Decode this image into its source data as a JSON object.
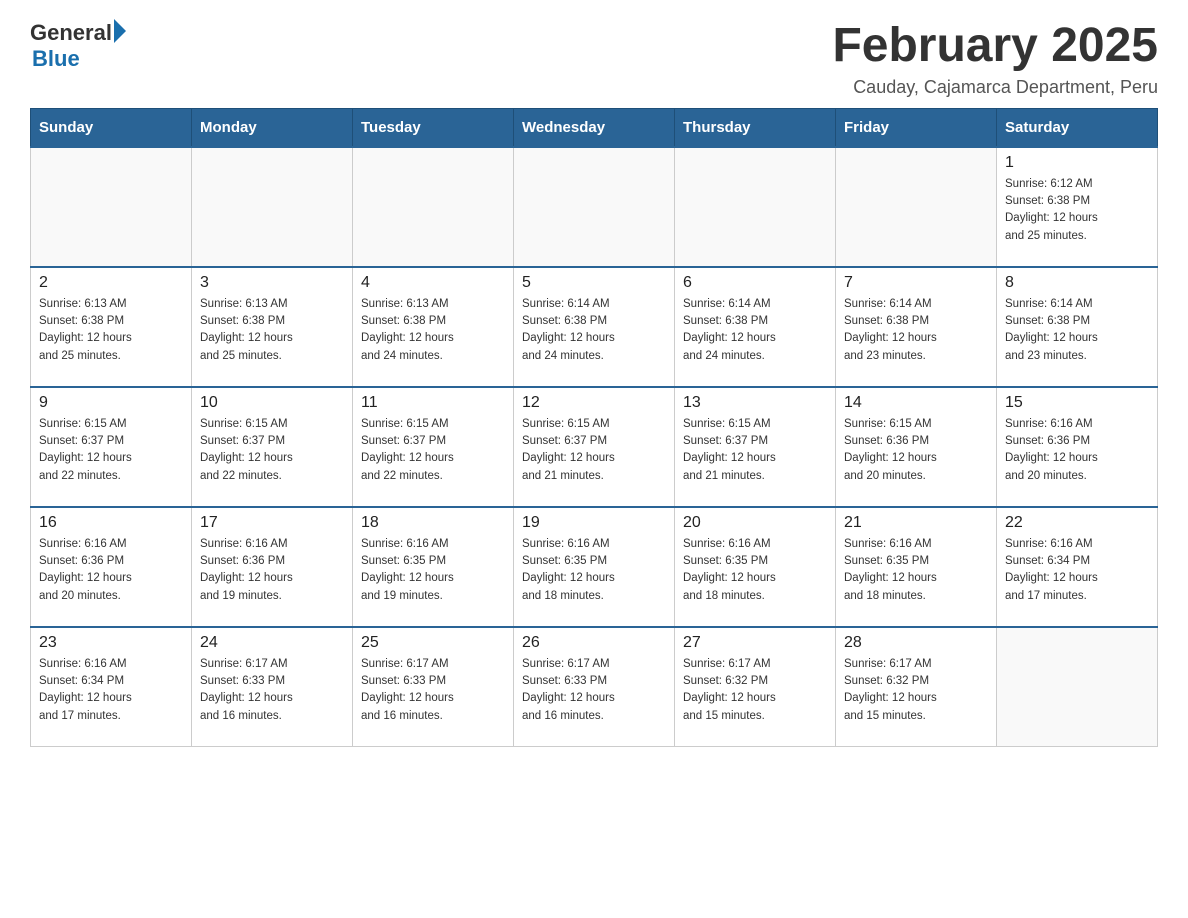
{
  "logo": {
    "general": "General",
    "blue": "Blue",
    "arrow_color": "#1a6fad"
  },
  "title": "February 2025",
  "location": "Cauday, Cajamarca Department, Peru",
  "header": {
    "days": [
      "Sunday",
      "Monday",
      "Tuesday",
      "Wednesday",
      "Thursday",
      "Friday",
      "Saturday"
    ]
  },
  "weeks": [
    {
      "cells": [
        {
          "day": "",
          "info": ""
        },
        {
          "day": "",
          "info": ""
        },
        {
          "day": "",
          "info": ""
        },
        {
          "day": "",
          "info": ""
        },
        {
          "day": "",
          "info": ""
        },
        {
          "day": "",
          "info": ""
        },
        {
          "day": "1",
          "info": "Sunrise: 6:12 AM\nSunset: 6:38 PM\nDaylight: 12 hours\nand 25 minutes."
        }
      ]
    },
    {
      "cells": [
        {
          "day": "2",
          "info": "Sunrise: 6:13 AM\nSunset: 6:38 PM\nDaylight: 12 hours\nand 25 minutes."
        },
        {
          "day": "3",
          "info": "Sunrise: 6:13 AM\nSunset: 6:38 PM\nDaylight: 12 hours\nand 25 minutes."
        },
        {
          "day": "4",
          "info": "Sunrise: 6:13 AM\nSunset: 6:38 PM\nDaylight: 12 hours\nand 24 minutes."
        },
        {
          "day": "5",
          "info": "Sunrise: 6:14 AM\nSunset: 6:38 PM\nDaylight: 12 hours\nand 24 minutes."
        },
        {
          "day": "6",
          "info": "Sunrise: 6:14 AM\nSunset: 6:38 PM\nDaylight: 12 hours\nand 24 minutes."
        },
        {
          "day": "7",
          "info": "Sunrise: 6:14 AM\nSunset: 6:38 PM\nDaylight: 12 hours\nand 23 minutes."
        },
        {
          "day": "8",
          "info": "Sunrise: 6:14 AM\nSunset: 6:38 PM\nDaylight: 12 hours\nand 23 minutes."
        }
      ]
    },
    {
      "cells": [
        {
          "day": "9",
          "info": "Sunrise: 6:15 AM\nSunset: 6:37 PM\nDaylight: 12 hours\nand 22 minutes."
        },
        {
          "day": "10",
          "info": "Sunrise: 6:15 AM\nSunset: 6:37 PM\nDaylight: 12 hours\nand 22 minutes."
        },
        {
          "day": "11",
          "info": "Sunrise: 6:15 AM\nSunset: 6:37 PM\nDaylight: 12 hours\nand 22 minutes."
        },
        {
          "day": "12",
          "info": "Sunrise: 6:15 AM\nSunset: 6:37 PM\nDaylight: 12 hours\nand 21 minutes."
        },
        {
          "day": "13",
          "info": "Sunrise: 6:15 AM\nSunset: 6:37 PM\nDaylight: 12 hours\nand 21 minutes."
        },
        {
          "day": "14",
          "info": "Sunrise: 6:15 AM\nSunset: 6:36 PM\nDaylight: 12 hours\nand 20 minutes."
        },
        {
          "day": "15",
          "info": "Sunrise: 6:16 AM\nSunset: 6:36 PM\nDaylight: 12 hours\nand 20 minutes."
        }
      ]
    },
    {
      "cells": [
        {
          "day": "16",
          "info": "Sunrise: 6:16 AM\nSunset: 6:36 PM\nDaylight: 12 hours\nand 20 minutes."
        },
        {
          "day": "17",
          "info": "Sunrise: 6:16 AM\nSunset: 6:36 PM\nDaylight: 12 hours\nand 19 minutes."
        },
        {
          "day": "18",
          "info": "Sunrise: 6:16 AM\nSunset: 6:35 PM\nDaylight: 12 hours\nand 19 minutes."
        },
        {
          "day": "19",
          "info": "Sunrise: 6:16 AM\nSunset: 6:35 PM\nDaylight: 12 hours\nand 18 minutes."
        },
        {
          "day": "20",
          "info": "Sunrise: 6:16 AM\nSunset: 6:35 PM\nDaylight: 12 hours\nand 18 minutes."
        },
        {
          "day": "21",
          "info": "Sunrise: 6:16 AM\nSunset: 6:35 PM\nDaylight: 12 hours\nand 18 minutes."
        },
        {
          "day": "22",
          "info": "Sunrise: 6:16 AM\nSunset: 6:34 PM\nDaylight: 12 hours\nand 17 minutes."
        }
      ]
    },
    {
      "cells": [
        {
          "day": "23",
          "info": "Sunrise: 6:16 AM\nSunset: 6:34 PM\nDaylight: 12 hours\nand 17 minutes."
        },
        {
          "day": "24",
          "info": "Sunrise: 6:17 AM\nSunset: 6:33 PM\nDaylight: 12 hours\nand 16 minutes."
        },
        {
          "day": "25",
          "info": "Sunrise: 6:17 AM\nSunset: 6:33 PM\nDaylight: 12 hours\nand 16 minutes."
        },
        {
          "day": "26",
          "info": "Sunrise: 6:17 AM\nSunset: 6:33 PM\nDaylight: 12 hours\nand 16 minutes."
        },
        {
          "day": "27",
          "info": "Sunrise: 6:17 AM\nSunset: 6:32 PM\nDaylight: 12 hours\nand 15 minutes."
        },
        {
          "day": "28",
          "info": "Sunrise: 6:17 AM\nSunset: 6:32 PM\nDaylight: 12 hours\nand 15 minutes."
        },
        {
          "day": "",
          "info": ""
        }
      ]
    }
  ]
}
